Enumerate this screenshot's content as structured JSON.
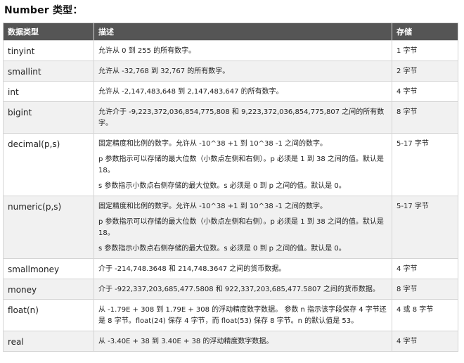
{
  "heading": "Number 类型：",
  "columns": [
    "数据类型",
    "描述",
    "存储"
  ],
  "rows": [
    {
      "type": "tinyint",
      "desc": [
        "允许从 0 到 255 的所有数字。"
      ],
      "storage": "1 字节"
    },
    {
      "type": "smallint",
      "desc": [
        "允许从 -32,768 到 32,767 的所有数字。"
      ],
      "storage": "2 字节"
    },
    {
      "type": "int",
      "desc": [
        "允许从 -2,147,483,648 到 2,147,483,647 的所有数字。"
      ],
      "storage": "4 字节"
    },
    {
      "type": "bigint",
      "desc": [
        "允许介于 -9,223,372,036,854,775,808 和 9,223,372,036,854,775,807 之间的所有数字。"
      ],
      "storage": "8 字节"
    },
    {
      "type": "decimal(p,s)",
      "desc": [
        "固定精度和比例的数字。允许从 -10^38 +1 到 10^38 -1 之间的数字。",
        "p 参数指示可以存储的最大位数（小数点左侧和右侧）。p 必须是 1 到 38 之间的值。默认是 18。",
        "s 参数指示小数点右侧存储的最大位数。s 必须是 0 到 p 之间的值。默认是 0。"
      ],
      "storage": "5-17 字节"
    },
    {
      "type": "numeric(p,s)",
      "desc": [
        "固定精度和比例的数字。允许从 -10^38 +1 到 10^38 -1 之间的数字。",
        "p 参数指示可以存储的最大位数（小数点左侧和右侧）。p 必须是 1 到 38 之间的值。默认是 18。",
        "s 参数指示小数点右侧存储的最大位数。s 必须是 0 到 p 之间的值。默认是 0。"
      ],
      "storage": "5-17 字节"
    },
    {
      "type": "smallmoney",
      "desc": [
        "介于 -214,748.3648 和 214,748.3647 之间的货币数据。"
      ],
      "storage": "4 字节"
    },
    {
      "type": "money",
      "desc": [
        "介于 -922,337,203,685,477.5808 和 922,337,203,685,477.5807 之间的货币数据。"
      ],
      "storage": "8 字节"
    },
    {
      "type": "float(n)",
      "desc": [
        "从 -1.79E + 308 到 1.79E + 308 的浮动精度数字数据。 参数 n 指示该字段保存 4 字节还是 8 字节。float(24) 保存 4 字节，而 float(53) 保存 8 字节。n 的默认值是 53。"
      ],
      "storage": "4 或 8 字节"
    },
    {
      "type": "real",
      "desc": [
        "从 -3.40E + 38 到 3.40E + 38 的浮动精度数字数据。"
      ],
      "storage": "4 字节"
    }
  ]
}
